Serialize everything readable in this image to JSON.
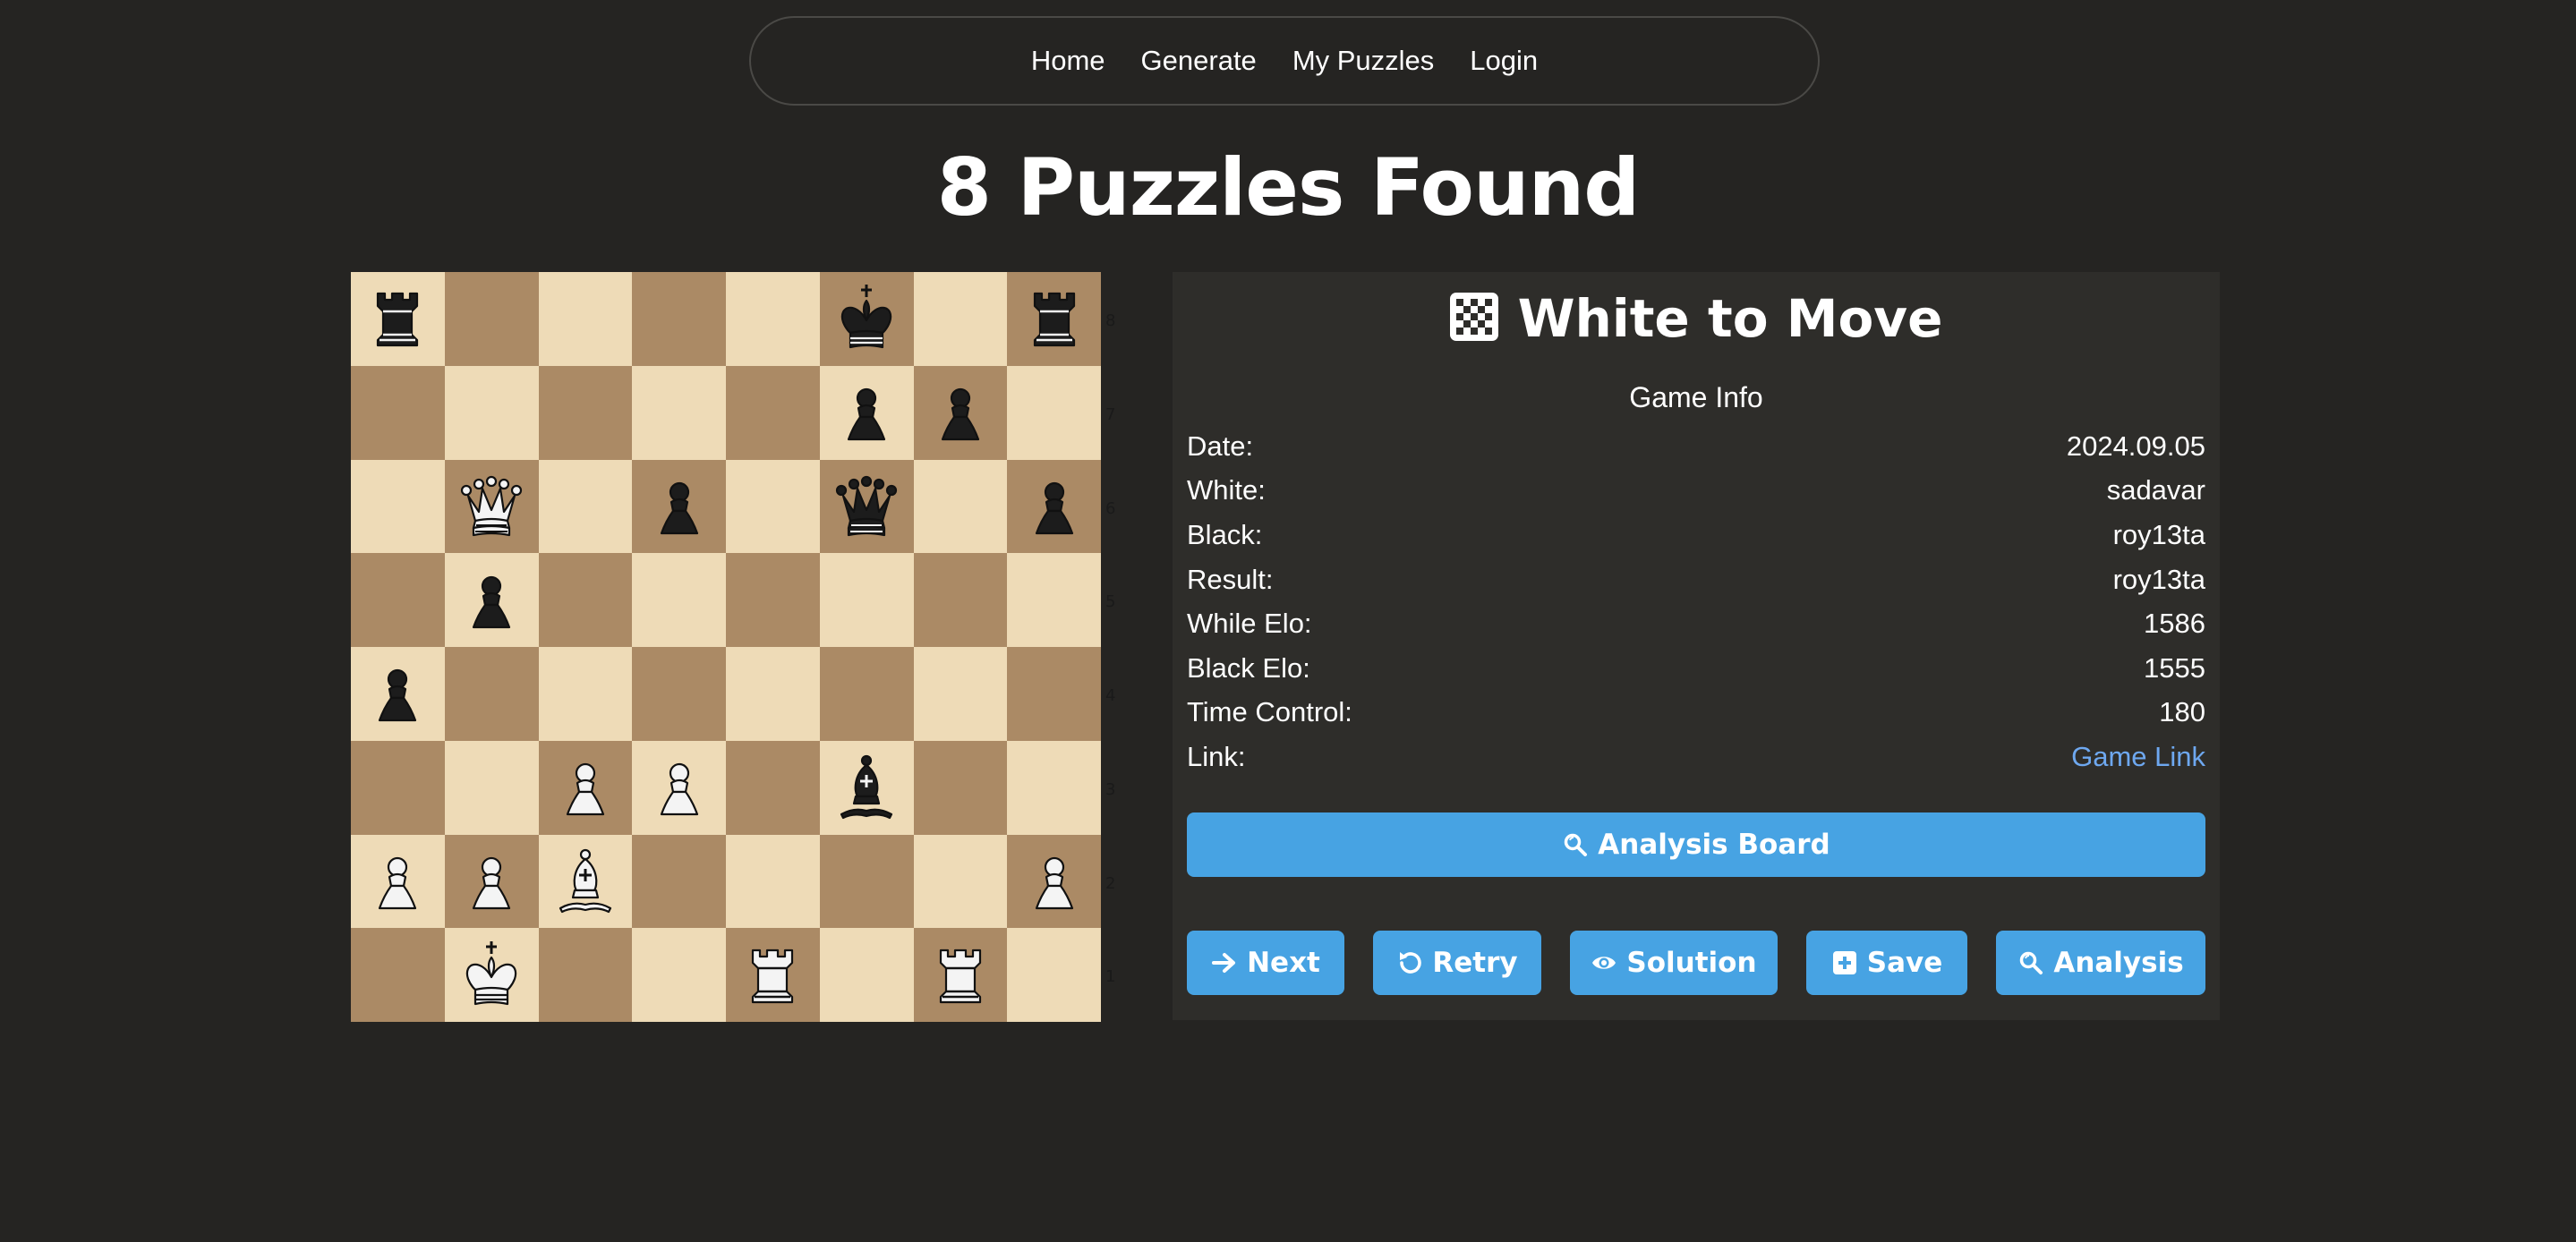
{
  "nav": {
    "items": [
      {
        "label": "Home"
      },
      {
        "label": "Generate"
      },
      {
        "label": "My Puzzles"
      },
      {
        "label": "Login"
      }
    ]
  },
  "page_title": "8 Puzzles Found",
  "board": {
    "ranks": [
      "8",
      "7",
      "6",
      "5",
      "4",
      "3",
      "2",
      "1"
    ],
    "position": [
      [
        "bR",
        "",
        "",
        "",
        "",
        "bK",
        "",
        "bR"
      ],
      [
        "",
        "",
        "",
        "",
        "",
        "bP",
        "bP",
        ""
      ],
      [
        "",
        "wQ",
        "",
        "bP",
        "",
        "bQ",
        "",
        "bP"
      ],
      [
        "",
        "bP",
        "",
        "",
        "",
        "",
        "",
        ""
      ],
      [
        "bP",
        "",
        "",
        "",
        "",
        "",
        "",
        ""
      ],
      [
        "",
        "",
        "wP",
        "wP",
        "",
        "bB",
        "",
        ""
      ],
      [
        "wP",
        "wP",
        "wB",
        "",
        "",
        "",
        "",
        "wP"
      ],
      [
        "",
        "wK",
        "",
        "",
        "wR",
        "",
        "wR",
        ""
      ]
    ]
  },
  "panel": {
    "title": "White to Move",
    "title_icon": "checkerboard-icon",
    "game_info_heading": "Game Info",
    "info": [
      {
        "label": "Date:",
        "value": "2024.09.05"
      },
      {
        "label": "White:",
        "value": "sadavar"
      },
      {
        "label": "Black:",
        "value": "roy13ta"
      },
      {
        "label": "Result:",
        "value": "roy13ta"
      },
      {
        "label": "While Elo:",
        "value": "1586"
      },
      {
        "label": "Black Elo:",
        "value": "1555"
      },
      {
        "label": "Time Control:",
        "value": "180"
      },
      {
        "label": "Link:",
        "value": "Game Link"
      }
    ],
    "analysis_board_label": "Analysis Board",
    "buttons": {
      "next": "Next",
      "retry": "Retry",
      "solution": "Solution",
      "save": "Save",
      "analysis": "Analysis"
    }
  },
  "colors": {
    "background": "#252422",
    "panel": "#2e2d2a",
    "light_square": "#eedbb7",
    "dark_square": "#ab8a65",
    "button": "#47a3e3",
    "link": "#6ea8f0"
  }
}
